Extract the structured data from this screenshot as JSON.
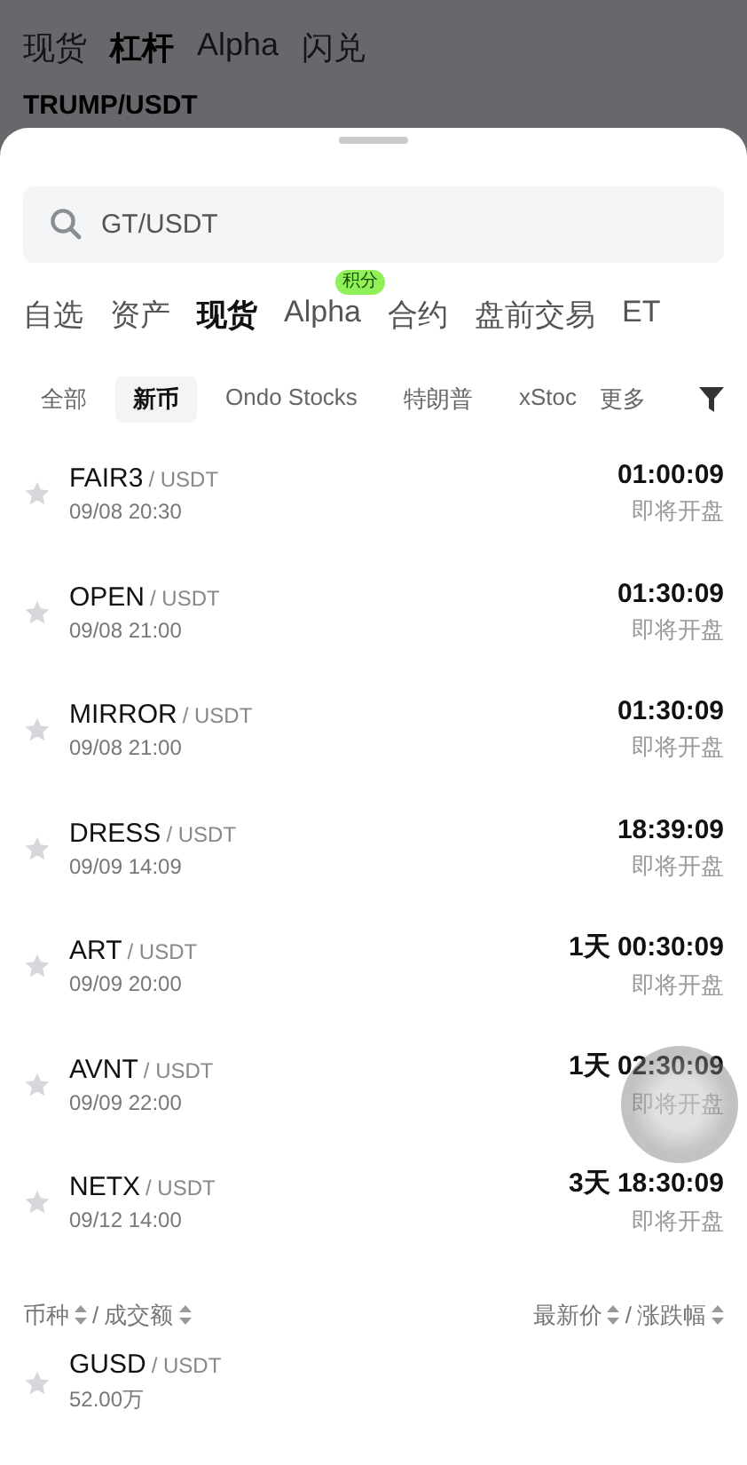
{
  "background": {
    "tabs": [
      {
        "label": "现货",
        "selected": false
      },
      {
        "label": "杠杆",
        "selected": true
      },
      {
        "label": "Alpha",
        "selected": false
      },
      {
        "label": "闪兑",
        "selected": false
      }
    ],
    "pair": "TRUMP/USDT"
  },
  "search": {
    "value": "GT/USDT"
  },
  "tabs": [
    {
      "label": "自选",
      "selected": false
    },
    {
      "label": "资产",
      "selected": false
    },
    {
      "label": "现货",
      "selected": true
    },
    {
      "label": "Alpha",
      "selected": false,
      "badge": "积分"
    },
    {
      "label": "合约",
      "selected": false
    },
    {
      "label": "盘前交易",
      "selected": false
    },
    {
      "label": "ET",
      "selected": false
    }
  ],
  "filters": [
    {
      "label": "全部",
      "selected": false
    },
    {
      "label": "新币",
      "selected": true
    },
    {
      "label": "Ondo Stocks",
      "selected": false
    },
    {
      "label": "特朗普",
      "selected": false
    },
    {
      "label": "xStoc",
      "selected": false
    }
  ],
  "more": "更多",
  "new_listings": [
    {
      "symbol": "FAIR3",
      "quote": "/ USDT",
      "time": "09/08 20:30",
      "countdown": "01:00:09",
      "status": "即将开盘",
      "starred": false
    },
    {
      "symbol": "OPEN",
      "quote": "/ USDT",
      "time": "09/08 21:00",
      "countdown": "01:30:09",
      "status": "即将开盘",
      "starred": false
    },
    {
      "symbol": "MIRROR",
      "quote": "/ USDT",
      "time": "09/08 21:00",
      "countdown": "01:30:09",
      "status": "即将开盘",
      "starred": false
    },
    {
      "symbol": "DRESS",
      "quote": "/ USDT",
      "time": "09/09 14:09",
      "countdown": "18:39:09",
      "status": "即将开盘",
      "starred": false
    },
    {
      "symbol": "ART",
      "quote": "/ USDT",
      "time": "09/09 20:00",
      "countdown": "1天 00:30:09",
      "status": "即将开盘",
      "starred": false
    },
    {
      "symbol": "AVNT",
      "quote": "/ USDT",
      "time": "09/09 22:00",
      "countdown": "1天 02:30:09",
      "status": "即将开盘",
      "starred": false
    },
    {
      "symbol": "NETX",
      "quote": "/ USDT",
      "time": "09/12 14:00",
      "countdown": "3天 18:30:09",
      "status": "即将开盘",
      "starred": false
    }
  ],
  "columns": {
    "left": [
      "币种",
      "成交额"
    ],
    "right": [
      "最新价",
      "涨跌幅"
    ],
    "separator": "/"
  },
  "markets": [
    {
      "symbol": "GUSD",
      "quote": "/ USDT",
      "volume": "52.00万",
      "starred": false
    }
  ]
}
